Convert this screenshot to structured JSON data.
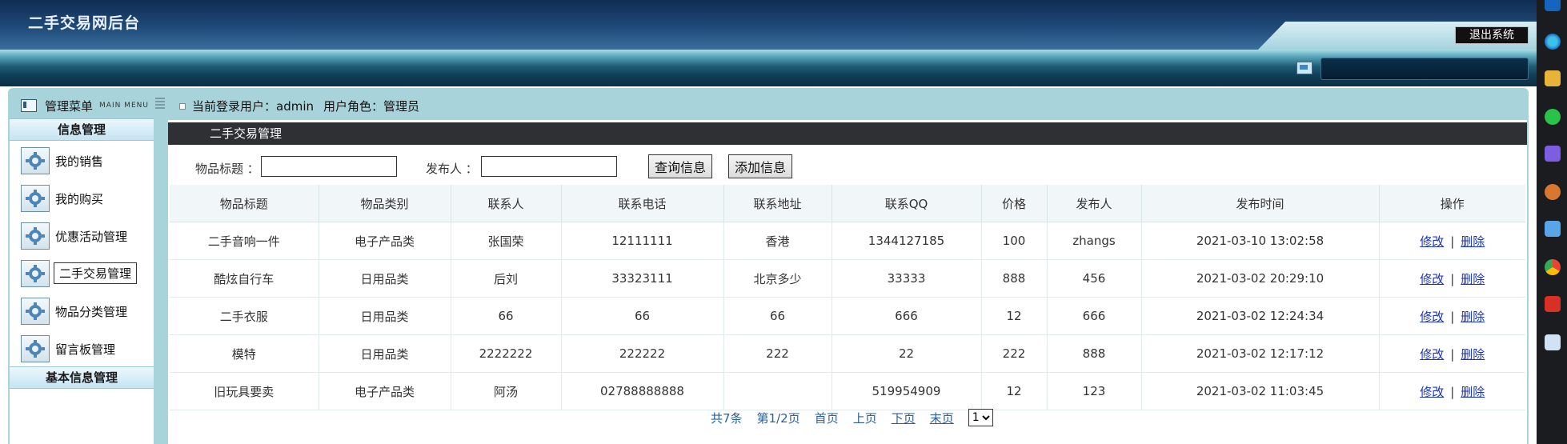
{
  "header": {
    "app_title": "二手交易网后台",
    "logout_label": "退出系统"
  },
  "menu": {
    "title": "管理菜单",
    "subtitle": "MAIN MENU",
    "sections": [
      {
        "title": "信息管理",
        "items": [
          {
            "label": "我的销售",
            "icon": "gear-icon"
          },
          {
            "label": "我的购买",
            "icon": "gear-icon"
          },
          {
            "label": "优惠活动管理",
            "icon": "gear-icon"
          },
          {
            "label": "二手交易管理",
            "icon": "gear-icon",
            "active": true
          },
          {
            "label": "物品分类管理",
            "icon": "gear-icon"
          },
          {
            "label": "留言板管理",
            "icon": "gear-icon"
          }
        ]
      },
      {
        "title": "基本信息管理",
        "items": []
      }
    ]
  },
  "status": {
    "user_label": "当前登录用户：admin",
    "role_label": "用户角色：管理员"
  },
  "page": {
    "title": "二手交易管理",
    "search": {
      "title_label": "物品标题 ：",
      "title_value": "",
      "publisher_label": "发布人 ：",
      "publisher_value": "",
      "query_button": "查询信息",
      "add_button": "添加信息"
    },
    "table": {
      "columns": [
        "物品标题",
        "物品类别",
        "联系人",
        "联系电话",
        "联系地址",
        "联系QQ",
        "价格",
        "发布人",
        "发布时间",
        "操作"
      ],
      "rows": [
        [
          "二手音响一件",
          "电子产品类",
          "张国荣",
          "12111111",
          "香港",
          "1344127185",
          "100",
          "zhangs",
          "2021-03-10 13:02:58"
        ],
        [
          "酷炫自行车",
          "日用品类",
          "后刘",
          "33323111",
          "北京多少",
          "33333",
          "888",
          "456",
          "2021-03-02 20:29:10"
        ],
        [
          "二手衣服",
          "日用品类",
          "66",
          "66",
          "66",
          "666",
          "12",
          "666",
          "2021-03-02 12:24:34"
        ],
        [
          "模特",
          "日用品类",
          "2222222",
          "222222",
          "222",
          "22",
          "222",
          "888",
          "2021-03-02 12:17:12"
        ],
        [
          "旧玩具要卖",
          "电子产品类",
          "阿汤",
          "02788888888",
          "",
          "519954909",
          "12",
          "123",
          "2021-03-02 11:03:45"
        ]
      ],
      "edit_label": "修改",
      "action_separator": "|",
      "delete_label": "删除"
    },
    "pager": {
      "total": "共7条",
      "page_info": "第1/2页",
      "first": "首页",
      "prev": "上页",
      "next": "下页",
      "last": "末页",
      "selected_page": "1"
    }
  },
  "colors": {
    "header_dark": "#0f2d52",
    "panel_bg": "#a9d3db",
    "page_head_bg": "#2f3033",
    "link": "#1a34c8",
    "pager": "#2a5fa0"
  }
}
